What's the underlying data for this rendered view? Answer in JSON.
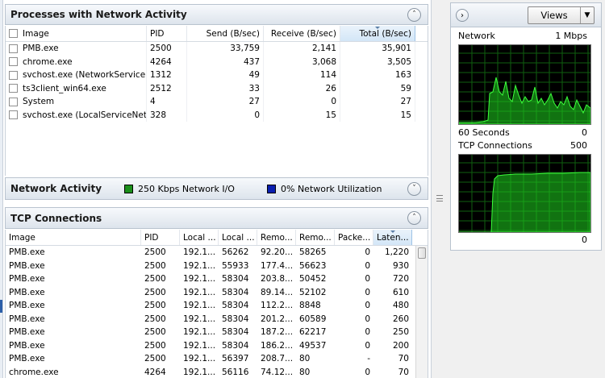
{
  "processes": {
    "title": "Processes with Network Activity",
    "columns": [
      "Image",
      "PID",
      "Send (B/sec)",
      "Receive (B/sec)",
      "Total (B/sec)"
    ],
    "rows": [
      {
        "image": "PMB.exe",
        "pid": "2500",
        "send": "33,759",
        "receive": "2,141",
        "total": "35,901"
      },
      {
        "image": "chrome.exe",
        "pid": "4264",
        "send": "437",
        "receive": "3,068",
        "total": "3,505"
      },
      {
        "image": "svchost.exe (NetworkService)",
        "pid": "1312",
        "send": "49",
        "receive": "114",
        "total": "163"
      },
      {
        "image": "ts3client_win64.exe",
        "pid": "2512",
        "send": "33",
        "receive": "26",
        "total": "59"
      },
      {
        "image": "System",
        "pid": "4",
        "send": "27",
        "receive": "0",
        "total": "27"
      },
      {
        "image": "svchost.exe (LocalServiceNet...",
        "pid": "328",
        "send": "0",
        "receive": "15",
        "total": "15"
      }
    ]
  },
  "network_activity": {
    "title": "Network Activity",
    "io_label": "250 Kbps Network I/O",
    "util_label": "0% Network Utilization",
    "io_color": "#1b8f1b",
    "util_color": "#0a1fb0"
  },
  "tcp": {
    "title": "TCP Connections",
    "columns": [
      "Image",
      "PID",
      "Local ...",
      "Local ...",
      "Remo...",
      "Remo...",
      "Packe...",
      "Laten..."
    ],
    "rows": [
      {
        "image": "PMB.exe",
        "pid": "2500",
        "laddr": "192.1...",
        "lport": "56262",
        "raddr": "92.20...",
        "rport": "58265",
        "loss": "0",
        "latency": "1,220"
      },
      {
        "image": "PMB.exe",
        "pid": "2500",
        "laddr": "192.1...",
        "lport": "55933",
        "raddr": "177.4...",
        "rport": "56623",
        "loss": "0",
        "latency": "930"
      },
      {
        "image": "PMB.exe",
        "pid": "2500",
        "laddr": "192.1...",
        "lport": "58304",
        "raddr": "203.8...",
        "rport": "50452",
        "loss": "0",
        "latency": "720"
      },
      {
        "image": "PMB.exe",
        "pid": "2500",
        "laddr": "192.1...",
        "lport": "58304",
        "raddr": "89.14...",
        "rport": "52102",
        "loss": "0",
        "latency": "610"
      },
      {
        "image": "PMB.exe",
        "pid": "2500",
        "laddr": "192.1...",
        "lport": "58304",
        "raddr": "112.2...",
        "rport": "8848",
        "loss": "0",
        "latency": "480"
      },
      {
        "image": "PMB.exe",
        "pid": "2500",
        "laddr": "192.1...",
        "lport": "58304",
        "raddr": "201.2...",
        "rport": "60589",
        "loss": "0",
        "latency": "260"
      },
      {
        "image": "PMB.exe",
        "pid": "2500",
        "laddr": "192.1...",
        "lport": "58304",
        "raddr": "187.2...",
        "rport": "62217",
        "loss": "0",
        "latency": "250"
      },
      {
        "image": "PMB.exe",
        "pid": "2500",
        "laddr": "192.1...",
        "lport": "58304",
        "raddr": "186.2...",
        "rport": "49537",
        "loss": "0",
        "latency": "200"
      },
      {
        "image": "PMB.exe",
        "pid": "2500",
        "laddr": "192.1...",
        "lport": "56397",
        "raddr": "208.7...",
        "rport": "80",
        "loss": "-",
        "latency": "70"
      },
      {
        "image": "chrome.exe",
        "pid": "4264",
        "laddr": "192.1...",
        "lport": "56116",
        "raddr": "74.12...",
        "rport": "80",
        "loss": "0",
        "latency": "70"
      }
    ]
  },
  "sidebar": {
    "views_label": "Views",
    "network_graph": {
      "label": "Network",
      "max_label": "1 Mbps",
      "time_label": "60 Seconds",
      "min_label": "0"
    },
    "tcp_graph": {
      "label": "TCP Connections",
      "max_label": "500",
      "min_label": "0"
    },
    "graph_color": "#1fd11f"
  }
}
